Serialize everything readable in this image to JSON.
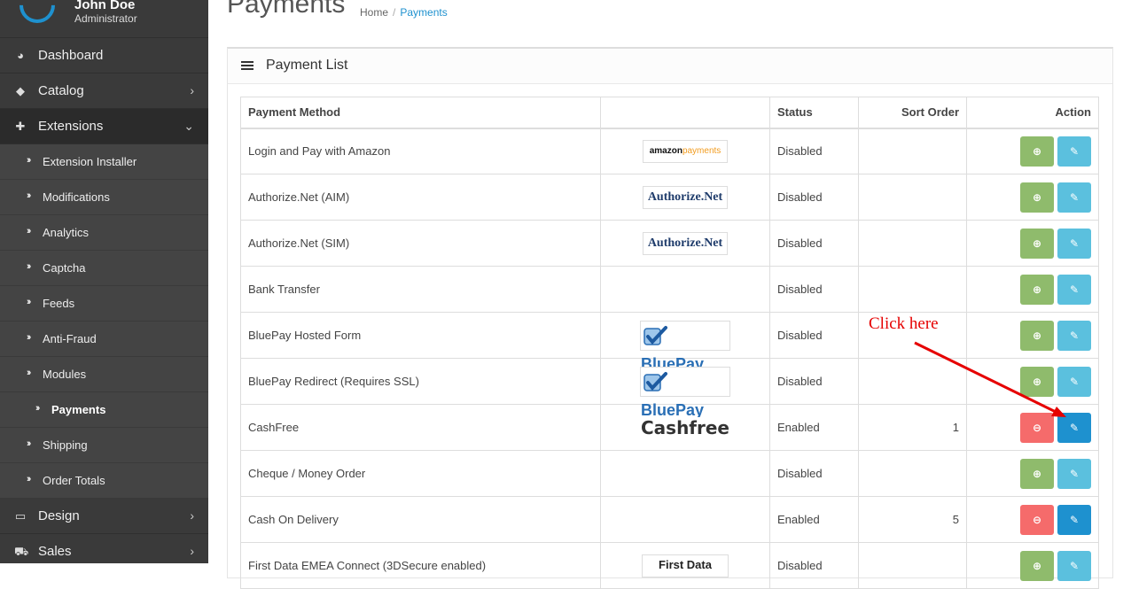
{
  "profile": {
    "name": "John Doe",
    "role": "Administrator"
  },
  "nav": {
    "dashboard": "Dashboard",
    "catalog": "Catalog",
    "extensions": "Extensions",
    "sub": [
      "Extension Installer",
      "Modifications",
      "Analytics",
      "Captcha",
      "Feeds",
      "Anti-Fraud",
      "Modules",
      "Payments",
      "Shipping",
      "Order Totals"
    ],
    "design": "Design",
    "sales": "Sales"
  },
  "page": {
    "title": "Payments",
    "breadcrumb": {
      "home": "Home",
      "current": "Payments"
    }
  },
  "panel": {
    "title": "Payment List"
  },
  "table": {
    "headers": {
      "method": "Payment Method",
      "logo": "",
      "status": "Status",
      "sort_order": "Sort Order",
      "action": "Action"
    },
    "rows": [
      {
        "method": "Login and Pay with Amazon",
        "status": "Disabled",
        "sort": "",
        "logo": "amazon",
        "installed": false
      },
      {
        "method": "Authorize.Net (AIM)",
        "status": "Disabled",
        "sort": "",
        "logo": "authorize",
        "installed": false
      },
      {
        "method": "Authorize.Net (SIM)",
        "status": "Disabled",
        "sort": "",
        "logo": "authorize",
        "installed": false
      },
      {
        "method": "Bank Transfer",
        "status": "Disabled",
        "sort": "",
        "logo": "",
        "installed": false
      },
      {
        "method": "BluePay Hosted Form",
        "status": "Disabled",
        "sort": "",
        "logo": "bluepay",
        "installed": false
      },
      {
        "method": "BluePay Redirect (Requires SSL)",
        "status": "Disabled",
        "sort": "",
        "logo": "bluepay",
        "installed": false
      },
      {
        "method": "CashFree",
        "status": "Enabled",
        "sort": "1",
        "logo": "cashfree",
        "installed": true
      },
      {
        "method": "Cheque / Money Order",
        "status": "Disabled",
        "sort": "",
        "logo": "",
        "installed": false
      },
      {
        "method": "Cash On Delivery",
        "status": "Enabled",
        "sort": "5",
        "logo": "",
        "installed": true
      },
      {
        "method": "First Data EMEA Connect (3DSecure enabled)",
        "status": "Disabled",
        "sort": "",
        "logo": "firstdata",
        "installed": false
      }
    ]
  },
  "logos": {
    "amazon_a": "amazon",
    "amazon_b": "payments",
    "authorize": "Authorize.Net",
    "bluepay": "BluePay",
    "cashfree": "Cashfree",
    "firstdata": "First Data"
  },
  "annotation": {
    "text": "Click here",
    "color": "#e60000"
  },
  "colors": {
    "sidebar": "#3a3a3a",
    "accent": "#1e91cf",
    "install": "#8fbb6c",
    "uninstall": "#f56b6b",
    "edit_disabled": "#5bc0de",
    "edit": "#1e91cf"
  },
  "icons": {
    "install": "plus-circle-icon",
    "uninstall": "minus-circle-icon",
    "edit": "pencil-icon"
  }
}
